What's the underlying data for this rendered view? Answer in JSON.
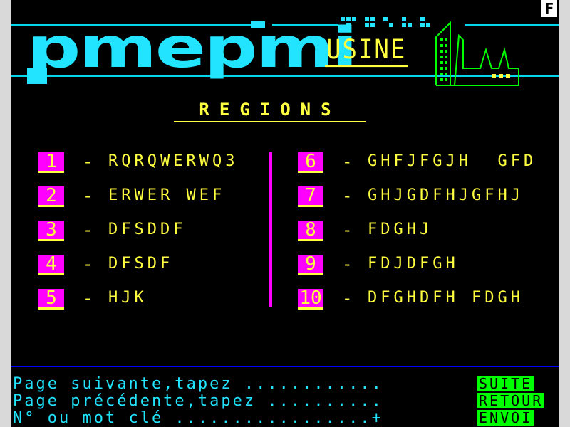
{
  "corner_indicator": "F",
  "logo": {
    "text": "pmepmi"
  },
  "banner": {
    "subtitle": "USINE"
  },
  "section_title": "REGIONS",
  "regions_left": [
    {
      "num": "1",
      "label": "RQRQWERWQ3"
    },
    {
      "num": "2",
      "label": "ERWER WEF"
    },
    {
      "num": "3",
      "label": "DFSDDF"
    },
    {
      "num": "4",
      "label": "DFSDF"
    },
    {
      "num": "5",
      "label": "HJK"
    }
  ],
  "regions_right": [
    {
      "num": "6",
      "label": "GHFJFGJH  GFD"
    },
    {
      "num": "7",
      "label": "GHJGDFHJGFHJ"
    },
    {
      "num": "8",
      "label": "FDGHJ"
    },
    {
      "num": "9",
      "label": "FDJDFGH"
    },
    {
      "num": "10",
      "label": "DFGHDFH FDGH"
    }
  ],
  "separator": "-",
  "footer": {
    "next_prompt": "Page suivante,tapez ............",
    "prev_prompt": "Page précédente,tapez ..........",
    "keyword_prompt": "N° ou mot clé .................+",
    "next_key": "SUITE",
    "prev_key": "RETOUR",
    "send_key": "ENVOI"
  },
  "colors": {
    "background": "#000000",
    "cyan": "#22e4ff",
    "yellow": "#ffff40",
    "magenta": "#ff00ff",
    "green": "#00ff00",
    "blue": "#0000ff"
  }
}
